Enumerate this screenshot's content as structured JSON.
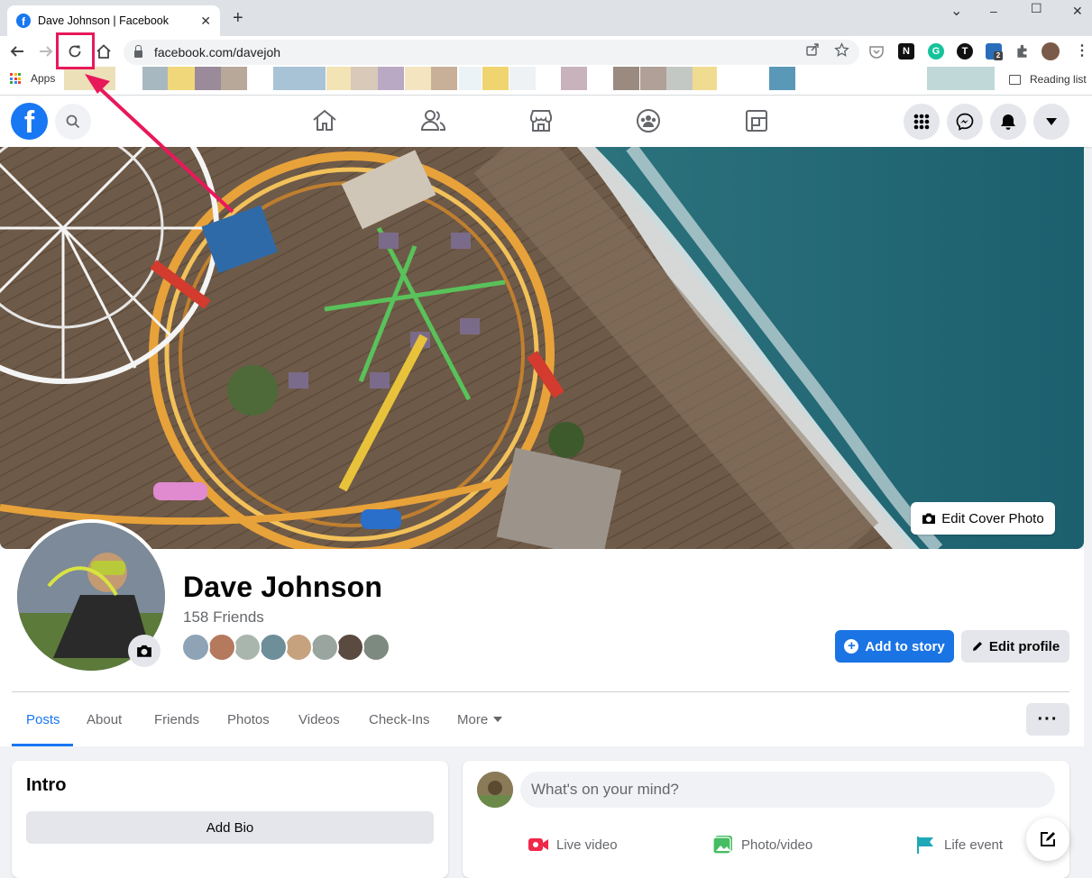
{
  "browser": {
    "tab_title": "Dave Johnson | Facebook",
    "tab_close": "✕",
    "new_tab": "+",
    "window_controls": {
      "minimize": "–",
      "maximize": "☐",
      "close": "✕",
      "chevron": "⌄"
    },
    "url": "facebook.com/davejoh",
    "apps_label": "Apps",
    "reading_list_label": "Reading list",
    "extension_badge": "2",
    "bookmark_colors": [
      "#ece0b8",
      "#a8b8c0",
      "#f0d77a",
      "#9a8a9a",
      "#b8a89a",
      "#a9c3d6",
      "#f3e3b5",
      "#d8c9b8",
      "#baa9c4",
      "#f5e4c0",
      "#c8b098",
      "#ecf3f7",
      "#f0d470",
      "#eef2f5",
      "#c8b2bc",
      "#9a8a80",
      "#b0a098",
      "#c4c8c4",
      "#f0dc90",
      "#5a98b8",
      "#c0d8d8"
    ]
  },
  "facebook": {
    "brand_color": "#1877f2",
    "profile_name": "Dave Johnson",
    "friends_count": "158 Friends",
    "add_to_story": "Add to story",
    "edit_profile": "Edit profile",
    "edit_cover": "Edit Cover Photo",
    "tabs": [
      "Posts",
      "About",
      "Friends",
      "Photos",
      "Videos",
      "Check-Ins",
      "More"
    ],
    "more_menu": "···",
    "intro_title": "Intro",
    "add_bio": "Add Bio",
    "composer_placeholder": "What's on your mind?",
    "actions": [
      "Live video",
      "Photo/video",
      "Life event"
    ],
    "friend_avatar_colors": [
      "#8ea3b6",
      "#b57a5e",
      "#a9b6ae",
      "#6e8e9a",
      "#c7a27f",
      "#9aa5a0",
      "#5a4a40",
      "#7d8a80"
    ]
  },
  "annotation": {
    "color": "#e8195b",
    "target": "reload-button"
  }
}
